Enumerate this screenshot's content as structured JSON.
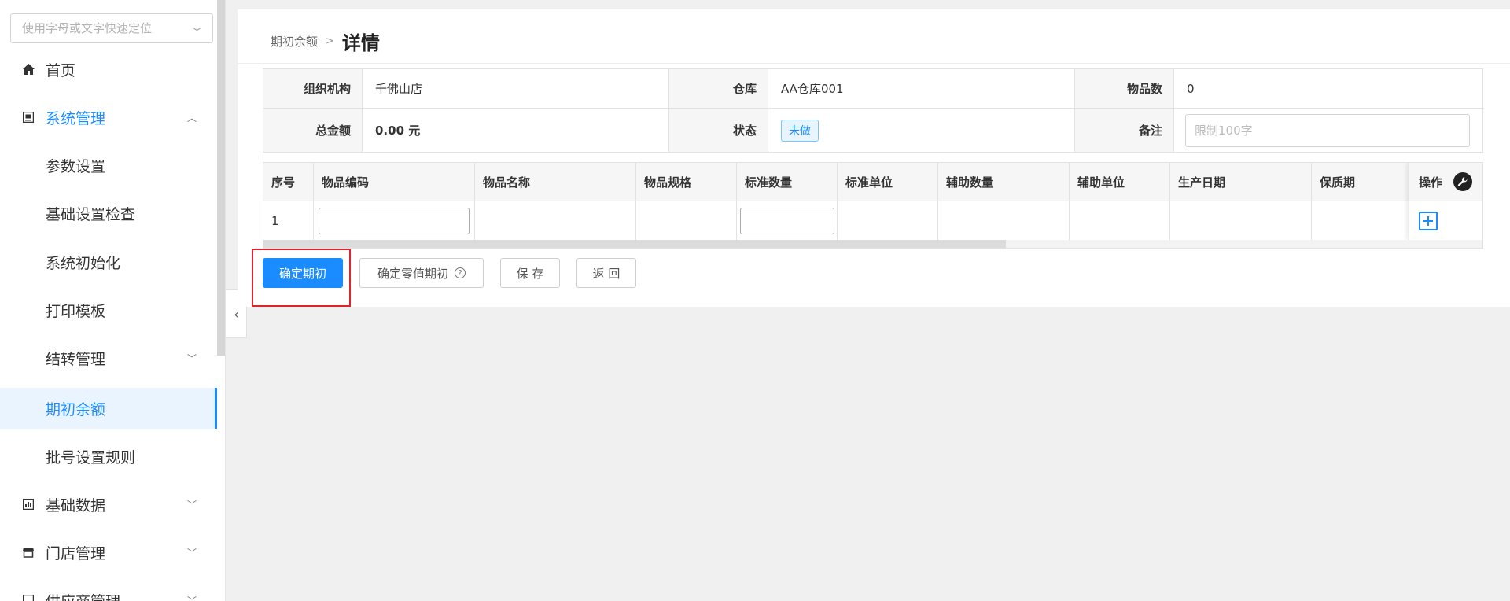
{
  "sidebar": {
    "search_placeholder": "使用字母或文字快速定位",
    "items": [
      {
        "label": "首页"
      },
      {
        "label": "系统管理"
      },
      {
        "label": "参数设置"
      },
      {
        "label": "基础设置检查"
      },
      {
        "label": "系统初始化"
      },
      {
        "label": "打印模板"
      },
      {
        "label": "结转管理"
      },
      {
        "label": "期初余额"
      },
      {
        "label": "批号设置规则"
      },
      {
        "label": "基础数据"
      },
      {
        "label": "门店管理"
      },
      {
        "label": "供应商管理"
      }
    ]
  },
  "breadcrumb": {
    "parent": "期初余额",
    "separator": ">",
    "current": "详情"
  },
  "info": {
    "org_label": "组织机构",
    "org_value": "千佛山店",
    "warehouse_label": "仓库",
    "warehouse_value": "AA仓库001",
    "count_label": "物品数",
    "count_value": "0",
    "amount_label": "总金额",
    "amount_value": "0.00 元",
    "status_label": "状态",
    "status_value": "未做",
    "remark_label": "备注",
    "remark_placeholder": "限制100字"
  },
  "table": {
    "columns": [
      "序号",
      "物品编码",
      "物品名称",
      "物品规格",
      "标准数量",
      "标准单位",
      "辅助数量",
      "辅助单位",
      "生产日期",
      "保质期"
    ],
    "action_header": "操作",
    "rows": [
      {
        "index": "1"
      }
    ]
  },
  "buttons": {
    "confirm": "确定期初",
    "confirm_zero": "确定零值期初",
    "save": "保 存",
    "back": "返 回"
  },
  "colors": {
    "accent": "#1a8cff",
    "highlight": "#e0242c"
  }
}
